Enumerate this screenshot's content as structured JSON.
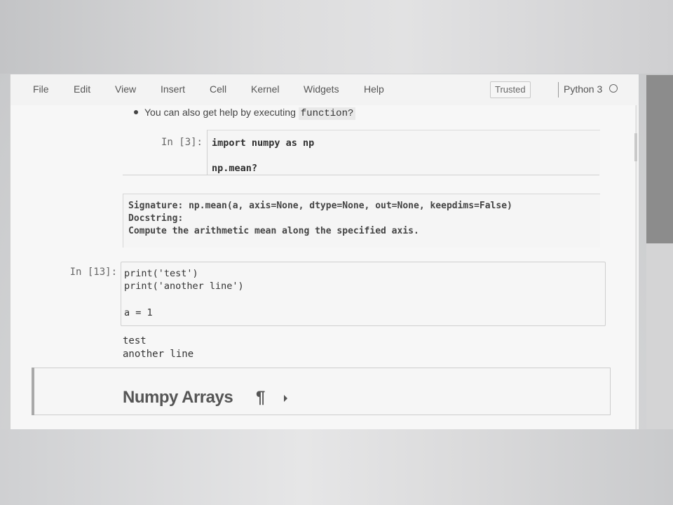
{
  "menubar": {
    "items": [
      "File",
      "Edit",
      "View",
      "Insert",
      "Cell",
      "Kernel",
      "Widgets",
      "Help"
    ],
    "trusted_label": "Trusted",
    "kernel_name": "Python 3"
  },
  "notebook": {
    "bullet": {
      "text": "You can also get help by executing ",
      "code": "function?"
    },
    "cell3": {
      "prompt": "In [3]:",
      "lines": [
        "import numpy as np",
        "",
        "np.mean?"
      ]
    },
    "pager": {
      "lines": [
        "Signature: np.mean(a, axis=None, dtype=None, out=None, keepdims=False)",
        "Docstring:",
        "Compute the arithmetic mean along the specified axis."
      ]
    },
    "cell13": {
      "prompt": "In [13]:",
      "lines": [
        "print('test')",
        "print('another line')",
        "",
        "a = 1"
      ],
      "output": [
        "test",
        "another line"
      ]
    },
    "markdown": {
      "heading": "Numpy Arrays",
      "anchor": "¶"
    }
  }
}
